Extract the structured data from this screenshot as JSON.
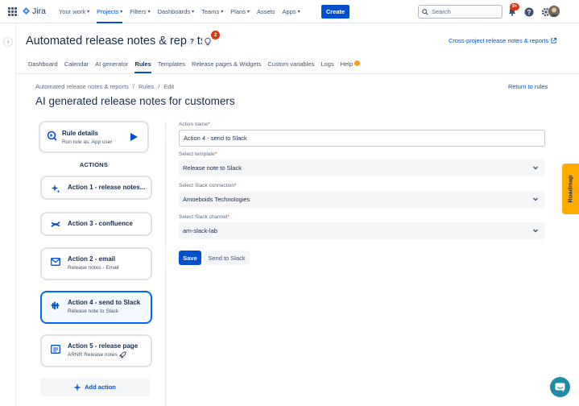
{
  "topnav": {
    "logo_text": "Jira",
    "items": [
      {
        "label": "Your work",
        "chevron": true
      },
      {
        "label": "Projects",
        "chevron": true,
        "active": true
      },
      {
        "label": "Filters",
        "chevron": true
      },
      {
        "label": "Dashboards",
        "chevron": true
      },
      {
        "label": "Teams",
        "chevron": true
      },
      {
        "label": "Plans",
        "chevron": true
      },
      {
        "label": "Assets",
        "chevron": false
      },
      {
        "label": "Apps",
        "chevron": true
      }
    ],
    "create_label": "Create",
    "search_placeholder": "Search",
    "notification_badge": "9+"
  },
  "header": {
    "app_title": "Automated release notes & reports",
    "help_label": "?",
    "bulb_badge": "2",
    "cross_project_link": "Cross-project release notes & reports"
  },
  "tabs": [
    {
      "label": "Dashboard"
    },
    {
      "label": "Calendar"
    },
    {
      "label": "AI generator"
    },
    {
      "label": "Rules",
      "active": true
    },
    {
      "label": "Templates"
    },
    {
      "label": "Release pages & Widgets"
    },
    {
      "label": "Custom variables"
    },
    {
      "label": "Logs"
    },
    {
      "label": "Help",
      "dot": true
    }
  ],
  "breadcrumb": {
    "items": [
      "Automated release notes & reports",
      "Rules",
      "Edit"
    ],
    "separator": "/"
  },
  "return_link": "Return to rules",
  "page_title": "AI generated release notes for customers",
  "rule_details": {
    "title": "Rule details",
    "subtitle": "Run rule as: App user"
  },
  "actions_heading": "ACTIONS",
  "actions": [
    {
      "title": "Action 1 - release notes...",
      "subtitle": "",
      "icon": "sparkle-icon"
    },
    {
      "title": "Action 3 - confluence",
      "subtitle": "",
      "icon": "confluence-icon"
    },
    {
      "title": "Action 2 - email",
      "subtitle": "Release notes - Email",
      "icon": "email-icon"
    },
    {
      "title": "Action 4 - send to Slack",
      "subtitle": "Release note to Slack",
      "icon": "slack-icon",
      "selected": true
    },
    {
      "title": "Action 5 - release page",
      "subtitle": "ARNR Release notes",
      "icon": "release-page-icon"
    }
  ],
  "add_action_label": "Add action",
  "form": {
    "action_name_label": "Action name",
    "action_name_value": "Action 4 - send to Slack",
    "template_label": "Select template",
    "template_value": "Release note to Slack",
    "connection_label": "Select Slack connection",
    "connection_value": "Amoeboids Technologies",
    "channel_label": "Select Slack channel",
    "channel_value": "arn-slack-lab",
    "required_mark": "*",
    "save_label": "Save",
    "send_label": "Send to Slack"
  },
  "roadmap_label": "Roadmap",
  "colors": {
    "primary": "#0052cc",
    "roadmap": "#ffab00",
    "badge": "#de350b",
    "chat": "#1f8ca4",
    "help_dot": "#ff991f"
  }
}
